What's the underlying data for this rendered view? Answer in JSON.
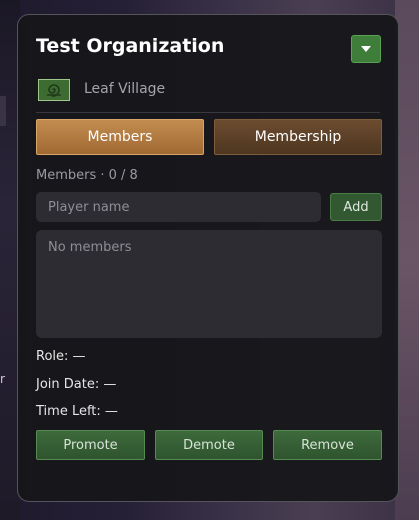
{
  "panel": {
    "title": "Test Organization",
    "village": {
      "icon": "leaf-village-emblem-icon",
      "name": "Leaf Village"
    }
  },
  "tabs": [
    {
      "label": "Members",
      "active": true
    },
    {
      "label": "Membership",
      "active": false
    }
  ],
  "members": {
    "count_label": "Members · 0 / 8",
    "input_placeholder": "Player name",
    "add_label": "Add",
    "empty_text": "No members"
  },
  "details": {
    "role": "Role: —",
    "join_date": "Join Date: —",
    "time_left": "Time Left: —"
  },
  "actions": {
    "promote": "Promote",
    "demote": "Demote",
    "remove": "Remove"
  },
  "background": {
    "left_fragment": "r"
  },
  "colors": {
    "active_tab": "#b07a40",
    "inactive_tab": "#5e422a",
    "action_green": "#3a6538",
    "dropdown_green": "#3f7d3a",
    "panel_bg": "#16161a"
  }
}
